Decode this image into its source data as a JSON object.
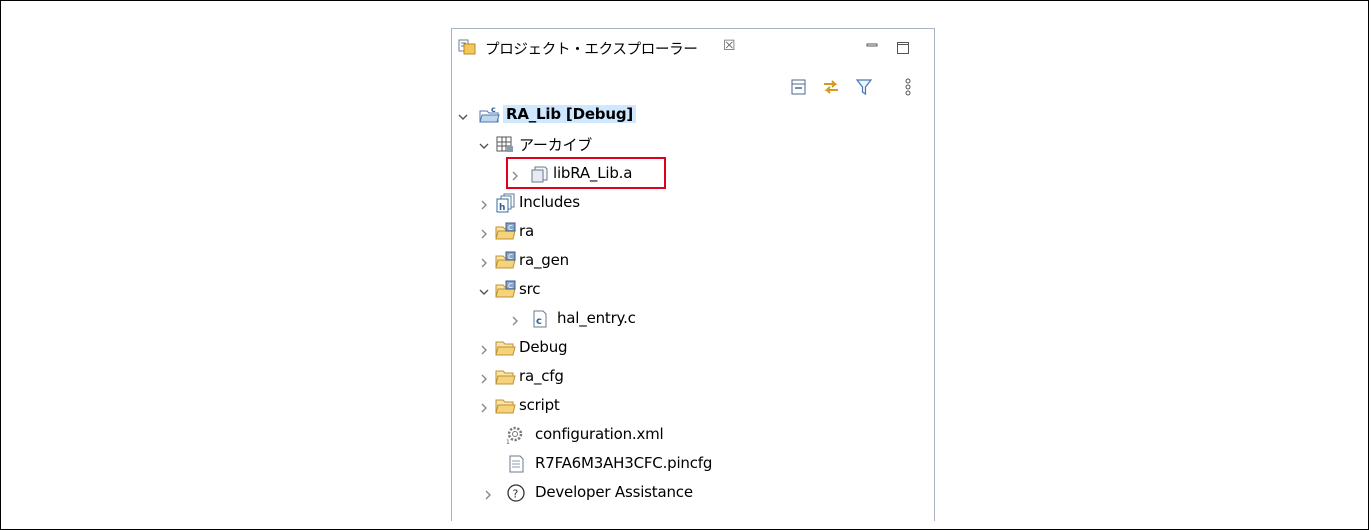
{
  "panel": {
    "title": "プロジェクト・エクスプローラー",
    "close_glyph": "☒"
  },
  "toolbar": {
    "icons": [
      "collapse-all-icon",
      "link-with-editor-icon",
      "filter-icon",
      "view-menu-icon"
    ]
  },
  "tree": {
    "items": [
      {
        "label": "RA_Lib [Debug]",
        "icon": "c-project-icon",
        "expanded": true,
        "selected": true
      },
      {
        "label": "アーカイブ",
        "icon": "archives-icon",
        "expanded": true
      },
      {
        "label": "libRA_Lib.a",
        "icon": "archive-file-icon",
        "expanded": false,
        "highlighted": true
      },
      {
        "label": "Includes",
        "icon": "includes-icon",
        "expanded": false
      },
      {
        "label": "ra",
        "icon": "source-folder-icon",
        "expanded": false
      },
      {
        "label": "ra_gen",
        "icon": "source-folder-icon",
        "expanded": false
      },
      {
        "label": "src",
        "icon": "source-folder-icon",
        "expanded": true
      },
      {
        "label": "hal_entry.c",
        "icon": "c-file-icon",
        "expanded": false
      },
      {
        "label": "Debug",
        "icon": "folder-icon",
        "expanded": false
      },
      {
        "label": "ra_cfg",
        "icon": "folder-icon",
        "expanded": false
      },
      {
        "label": "script",
        "icon": "folder-icon",
        "expanded": false
      },
      {
        "label": "configuration.xml",
        "icon": "configuration-gear-icon"
      },
      {
        "label": "R7FA6M3AH3CFC.pincfg",
        "icon": "text-file-icon"
      },
      {
        "label": "Developer Assistance",
        "icon": "help-circle-icon",
        "expanded": false
      }
    ]
  },
  "colors": {
    "highlight_border": "#e0001b",
    "selection_bg": "#cde8ff",
    "folder_yellow": "#f5d37a",
    "panel_border": "#a9b3c2"
  }
}
